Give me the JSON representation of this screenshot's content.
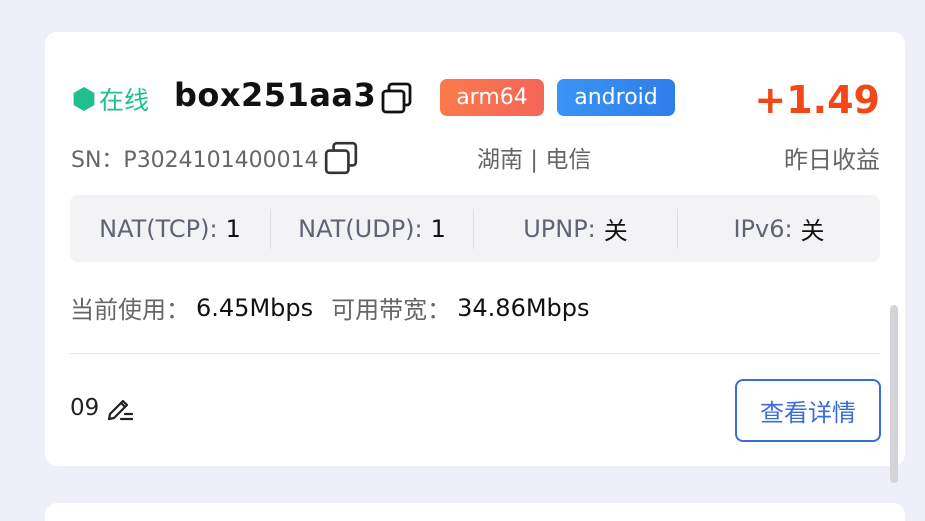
{
  "device": {
    "status_label": "在线",
    "name": "box251aa3",
    "tags": {
      "arch": "arm64",
      "os": "android"
    },
    "earning_value": "+1.49",
    "earning_label": "昨日收益",
    "sn": "SN：P3024101400014",
    "region": "湖南 | 电信"
  },
  "network": {
    "nat_tcp_label": "NAT(TCP):",
    "nat_tcp_value": "1",
    "nat_udp_label": "NAT(UDP):",
    "nat_udp_value": "1",
    "upnp_label": "UPNP:",
    "upnp_value": "关",
    "ipv6_label": "IPv6:",
    "ipv6_value": "关"
  },
  "bandwidth": {
    "current_label": "当前使用：",
    "current_value": "6.45Mbps",
    "available_label": "可用带宽：",
    "available_value": "34.86Mbps"
  },
  "footer": {
    "remark": "09",
    "detail_button": "查看详情"
  },
  "colors": {
    "online": "#1fc08d",
    "earning": "#f24818",
    "arch_tag": "#f46558",
    "os_tag": "#2f7eea",
    "button": "#3a6ddb",
    "background": "#eeeff8"
  },
  "icons": {
    "status": "hexagon-icon",
    "copy": "copy-icon",
    "edit": "edit-pencil-icon"
  }
}
